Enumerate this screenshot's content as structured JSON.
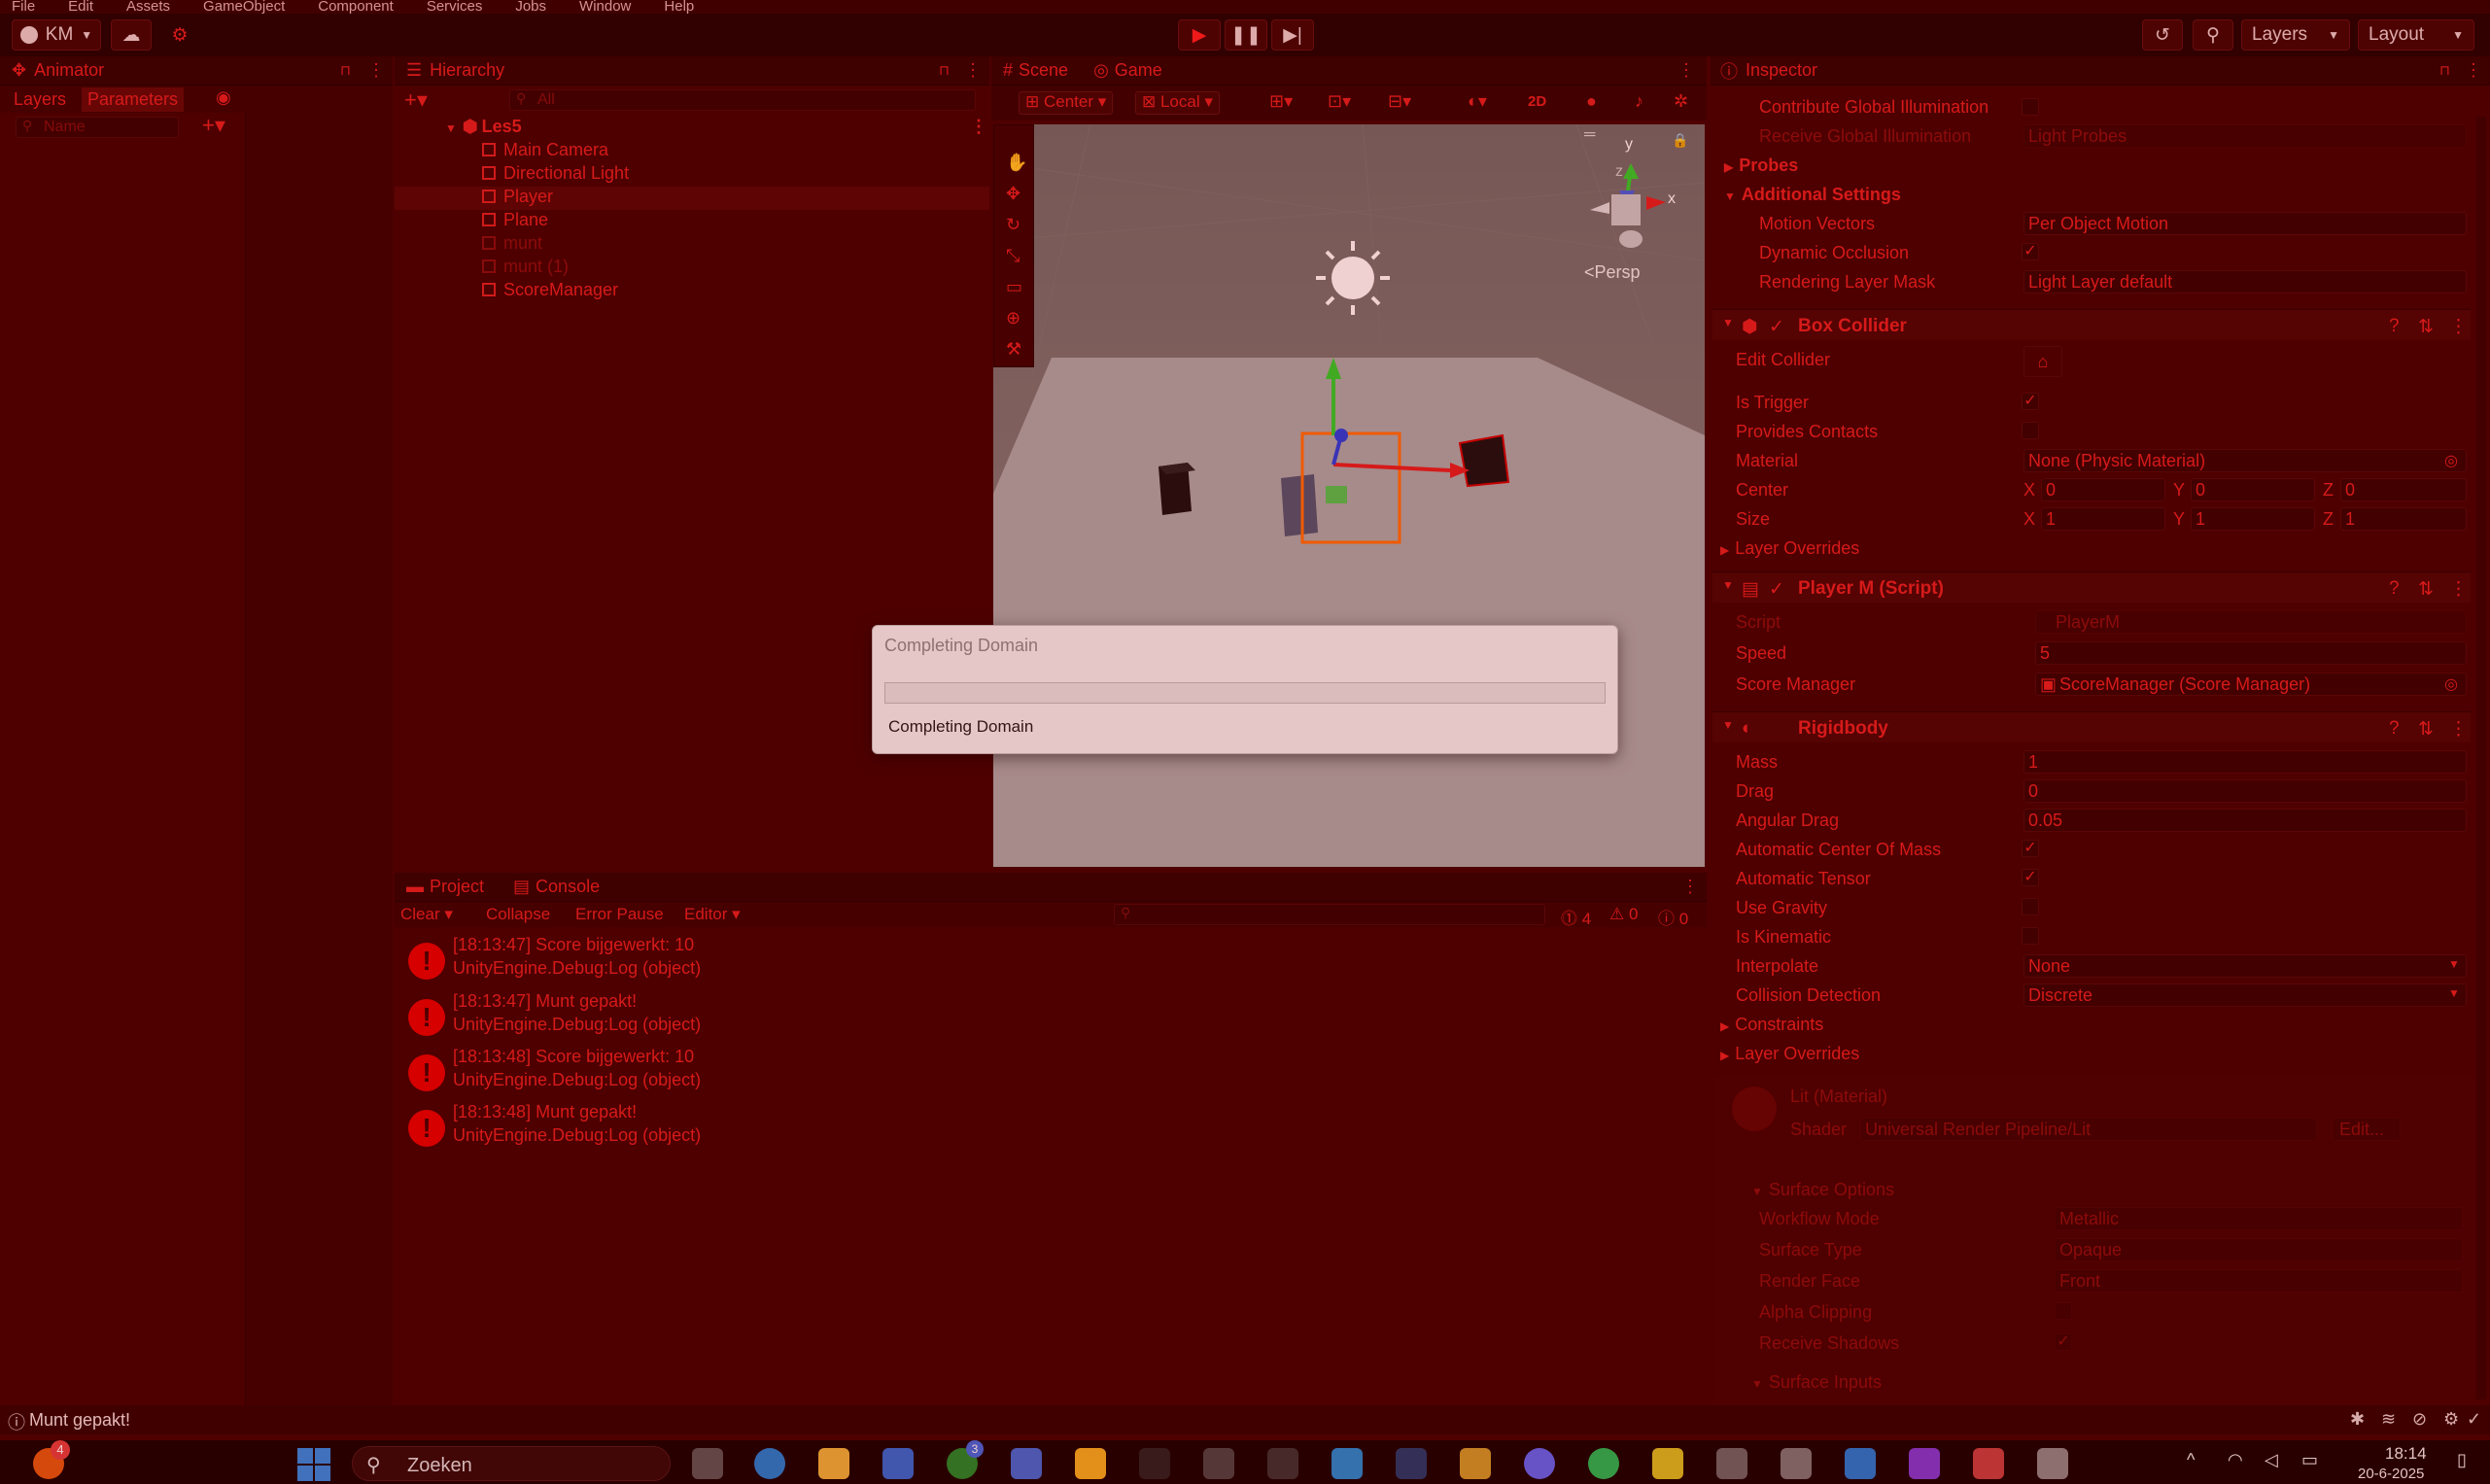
{
  "menu": [
    "File",
    "Edit",
    "Assets",
    "GameObject",
    "Component",
    "Services",
    "Jobs",
    "Window",
    "Help"
  ],
  "toolbar": {
    "account": "KM",
    "layers": "Layers",
    "layout": "Layout"
  },
  "animator": {
    "title": "Animator",
    "tab_layers": "Layers",
    "tab_parameters": "Parameters",
    "search_placeholder": "Name"
  },
  "hierarchy": {
    "title": "Hierarchy",
    "search_placeholder": "All",
    "scene": "Les5",
    "items": [
      "Main Camera",
      "Directional Light",
      "Player",
      "Plane",
      "munt",
      "munt (1)",
      "ScoreManager"
    ]
  },
  "scene": {
    "tab_scene": "Scene",
    "tab_game": "Game",
    "pivot": "Center",
    "space": "Local",
    "mode2d": "2D",
    "persp": "Persp",
    "axis_x": "x",
    "axis_y": "y",
    "axis_z": "z"
  },
  "dialog": {
    "title": "Completing Domain",
    "progress": 0.0,
    "status": "Completing Domain"
  },
  "project": {
    "tab_project": "Project",
    "tab_console": "Console",
    "clear": "Clear",
    "collapse": "Collapse",
    "error_pause": "Error Pause",
    "editor": "Editor",
    "count_errors": "4",
    "count_warnings": "0",
    "count_logs": "0"
  },
  "console": [
    {
      "line1": "[18:13:47] Score bijgewerkt: 10",
      "line2": "UnityEngine.Debug:Log (object)"
    },
    {
      "line1": "[18:13:47] Munt gepakt!",
      "line2": "UnityEngine.Debug:Log (object)"
    },
    {
      "line1": "[18:13:48] Score bijgewerkt: 10",
      "line2": "UnityEngine.Debug:Log (object)"
    },
    {
      "line1": "[18:13:48] Munt gepakt!",
      "line2": "UnityEngine.Debug:Log (object)"
    }
  ],
  "inspector": {
    "title": "Inspector",
    "contribute_gi": "Contribute Global Illumination",
    "receive_gi": "Receive Global Illumination",
    "receive_gi_val": "Light Probes",
    "probes": "Probes",
    "additional": "Additional Settings",
    "motion_vectors": "Motion Vectors",
    "motion_vectors_val": "Per Object Motion",
    "dynamic_occlusion": "Dynamic Occlusion",
    "rendering_layer": "Rendering Layer Mask",
    "rendering_layer_val": "Light Layer default",
    "box_collider": "Box Collider",
    "edit_collider": "Edit Collider",
    "is_trigger": "Is Trigger",
    "provides_contacts": "Provides Contacts",
    "material": "Material",
    "material_val": "None (Physic Material)",
    "center": "Center",
    "size": "Size",
    "cx": "0",
    "cy": "0",
    "cz": "0",
    "sx": "1",
    "sy": "1",
    "sz": "1",
    "layer_overrides": "Layer Overrides",
    "player_script": "Player M (Script)",
    "script": "Script",
    "script_val": "PlayerM",
    "speed": "Speed",
    "speed_val": "5",
    "score_manager": "Score Manager",
    "score_manager_val": "ScoreManager (Score Manager)",
    "rigidbody": "Rigidbody",
    "mass": "Mass",
    "mass_val": "1",
    "drag": "Drag",
    "drag_val": "0",
    "angular_drag": "Angular Drag",
    "angular_drag_val": "0.05",
    "auto_com": "Automatic Center Of Mass",
    "auto_tensor": "Automatic Tensor",
    "use_gravity": "Use Gravity",
    "is_kinematic": "Is Kinematic",
    "interpolate": "Interpolate",
    "interpolate_val": "None",
    "collision": "Collision Detection",
    "collision_val": "Discrete",
    "constraints": "Constraints",
    "layer_overrides2": "Layer Overrides",
    "material_lit": "Lit (Material)",
    "shader": "Shader",
    "shader_val": "Universal Render Pipeline/Lit",
    "edit": "Edit...",
    "surface_options": "Surface Options",
    "workflow": "Workflow Mode",
    "workflow_val": "Metallic",
    "surface_type": "Surface Type",
    "surface_type_val": "Opaque",
    "render_face": "Render Face",
    "render_face_val": "Front",
    "alpha_clip": "Alpha Clipping",
    "receive_shadows": "Receive Shadows",
    "surface_inputs": "Surface Inputs"
  },
  "statusbar": {
    "message": "Munt gepakt!"
  },
  "taskbar": {
    "search": "Zoeken",
    "time": "18:14",
    "date": "20-6-2025",
    "badge_firefox": "4",
    "badge_xbox": "3"
  }
}
